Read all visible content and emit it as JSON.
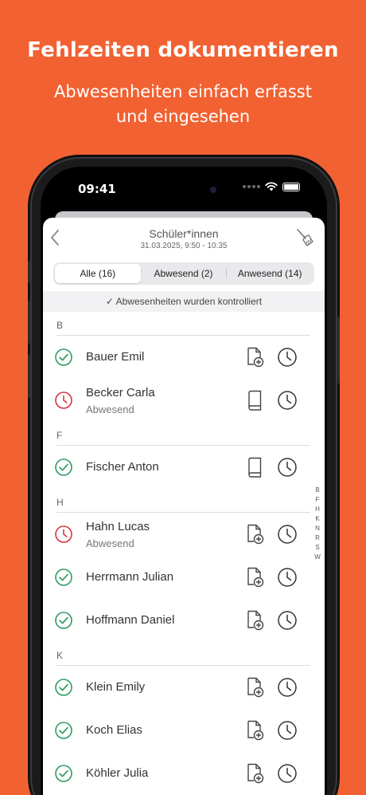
{
  "headline": "Fehlzeiten dokumentieren",
  "subline1": "Abwesenheiten einfach erfasst",
  "subline2": "und eingesehen",
  "status": {
    "time": "09:41"
  },
  "header": {
    "title": "Schüler*innen",
    "subtitle": "31.03.2025, 9:50 - 10:35"
  },
  "tabs": [
    {
      "label": "Alle (16)"
    },
    {
      "label": "Abwesend (2)"
    },
    {
      "label": "Anwesend (14)"
    }
  ],
  "banner": "✓ Abwesenheiten wurden kontrolliert",
  "sections": {
    "b": "B",
    "f": "F",
    "h": "H",
    "k": "K"
  },
  "students": {
    "bauer": {
      "name": "Bauer Emil"
    },
    "becker": {
      "name": "Becker Carla",
      "status": "Abwesend"
    },
    "fischer": {
      "name": "Fischer Anton"
    },
    "hahn": {
      "name": "Hahn Lucas",
      "status": "Abwesend"
    },
    "herrmann": {
      "name": "Herrmann Julian"
    },
    "hoffmann": {
      "name": "Hoffmann Daniel"
    },
    "klein": {
      "name": "Klein Emily"
    },
    "koch": {
      "name": "Koch Elias"
    },
    "koehler": {
      "name": "Köhler Julia"
    }
  },
  "index": [
    "B",
    "F",
    "H",
    "K",
    "N",
    "R",
    "S",
    "W"
  ],
  "colors": {
    "background": "#f26131",
    "present": "#2e9b62",
    "absent": "#d9333f"
  },
  "icons": [
    "chevron-left-icon",
    "broom-icon",
    "present-check-icon",
    "absent-clock-icon",
    "add-document-icon",
    "book-icon",
    "clock-icon"
  ]
}
